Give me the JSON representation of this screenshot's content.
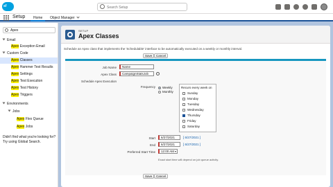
{
  "header": {
    "logo_text": "sf",
    "search_placeholder": "Search Setup"
  },
  "nav": {
    "app_name": "Setup",
    "tabs": [
      {
        "label": "Home"
      },
      {
        "label": "Object Manager"
      }
    ]
  },
  "sidebar": {
    "quickfind_value": "Apex",
    "items": [
      {
        "label": "Email",
        "hl": ""
      },
      {
        "label": "",
        "hl": "Apex",
        "rest": " Exception Email"
      },
      {
        "label": "Custom Code",
        "hl": ""
      },
      {
        "label": "",
        "hl": "Apex",
        "rest": " Classes"
      },
      {
        "label": "",
        "hl": "Apex",
        "rest": " Hammer Test Results"
      },
      {
        "label": "",
        "hl": "Apex",
        "rest": " Settings"
      },
      {
        "label": "",
        "hl": "Apex",
        "rest": " Test Execution"
      },
      {
        "label": "",
        "hl": "Apex",
        "rest": " Test History"
      },
      {
        "label": "",
        "hl": "Apex",
        "rest": " Triggers"
      },
      {
        "label": "Environments",
        "hl": ""
      },
      {
        "label": "Jobs",
        "hl": ""
      },
      {
        "label": "",
        "hl": "Apex",
        "rest": " Flex Queue"
      },
      {
        "label": "",
        "hl": "Apex",
        "rest": " Jobs"
      }
    ],
    "help_line1": "Didn't find what you're looking for?",
    "help_line2": "Try using Global Search."
  },
  "page": {
    "eyebrow": "SETUP",
    "title": "Apex Classes",
    "intro": "Schedule an Apex class that implements the 'Schedulable' interface to be automatically executed on a weekly or monthly interval."
  },
  "buttons": {
    "save": "Save",
    "cancel": "Cancel"
  },
  "form": {
    "job_name_label": "Job Name",
    "job_name_value": "Name",
    "apex_class_label": "Apex Class",
    "apex_class_value": "CampaignStatsJob",
    "section_label": "Schedule Apex Execution",
    "frequency_label": "Frequency",
    "weekly": "Weekly",
    "monthly": "Monthly",
    "recurs_label": "Recurs every week on",
    "days": [
      {
        "label": "Sunday",
        "checked": false
      },
      {
        "label": "Monday",
        "checked": false
      },
      {
        "label": "Tuesday",
        "checked": false
      },
      {
        "label": "Wednesday",
        "checked": false
      },
      {
        "label": "Thursday",
        "checked": true
      },
      {
        "label": "Friday",
        "checked": false
      },
      {
        "label": "Saturday",
        "checked": false
      }
    ],
    "start_label": "Start",
    "start_value": "6/27/2021",
    "start_link": "[ 6/27/2021 ]",
    "end_label": "End",
    "end_value": "6/27/2021",
    "end_link": "[ 6/27/2021 ]",
    "preferred_label": "Preferred Start Time",
    "preferred_value": "12:00 AM",
    "note": "Exact start time will depend on job queue activity."
  }
}
